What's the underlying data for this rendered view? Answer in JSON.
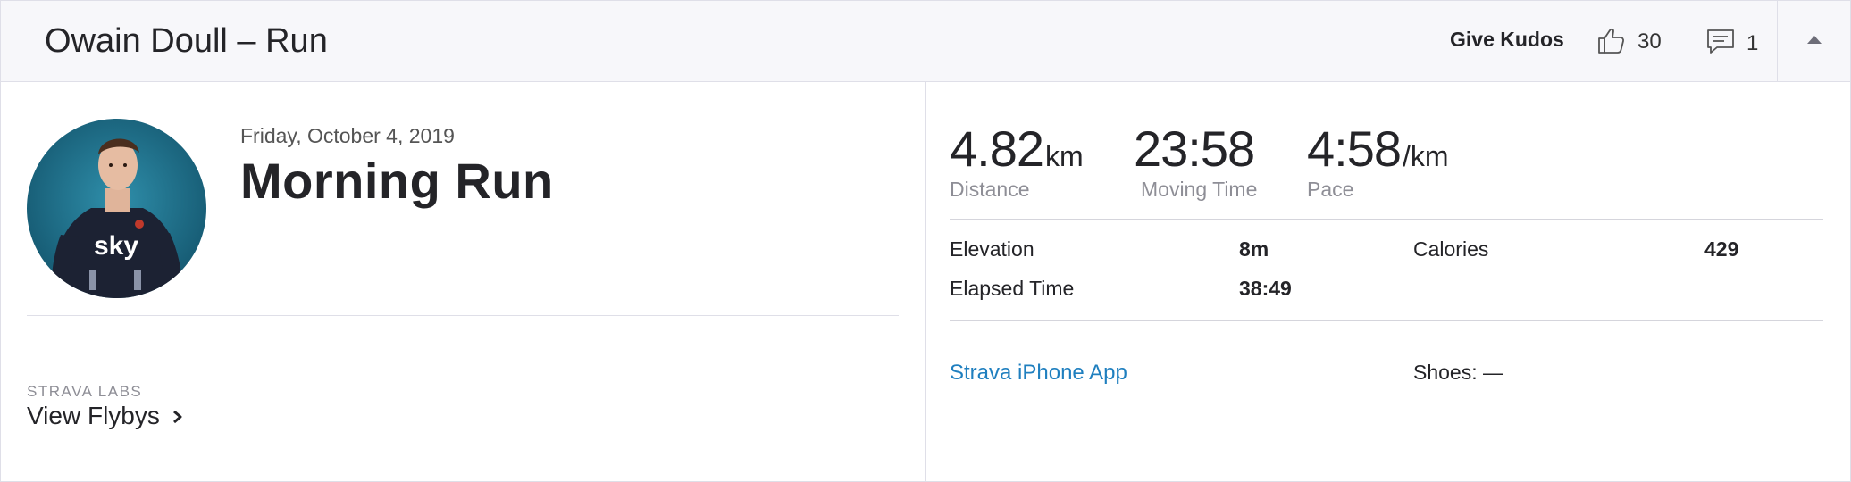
{
  "header": {
    "title": "Owain Doull – Run",
    "give_kudos_label": "Give Kudos",
    "kudos_count": "30",
    "comment_count": "1"
  },
  "activity": {
    "date": "Friday, October 4, 2019",
    "name": "Morning Run"
  },
  "labs": {
    "label": "STRAVA LABS",
    "flybys_label": "View Flybys"
  },
  "stats": [
    {
      "value": "4.82",
      "unit": "km",
      "label": "Distance"
    },
    {
      "value": "23:58",
      "unit": "",
      "label": "Moving Time"
    },
    {
      "value": "4:58",
      "unit": "/km",
      "label": "Pace"
    }
  ],
  "details": {
    "elevation_label": "Elevation",
    "elevation_value": "8m",
    "calories_label": "Calories",
    "calories_value": "429",
    "elapsed_label": "Elapsed Time",
    "elapsed_value": "38:49"
  },
  "device": {
    "app_link": "Strava iPhone App",
    "shoes": "Shoes: —"
  },
  "colors": {
    "header_bg": "#f7f7fa",
    "link": "#1f7fbf",
    "text": "#242428",
    "muted": "#8e8e96"
  },
  "icons": {
    "kudos": "thumbs-up-icon",
    "comment": "comment-icon",
    "collapse": "caret-up-icon",
    "flybys": "chevron-right-icon"
  }
}
